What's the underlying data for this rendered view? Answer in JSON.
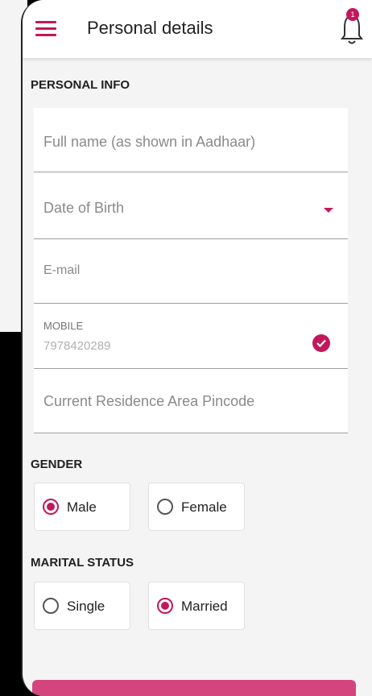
{
  "header": {
    "title": "Personal details",
    "menu_icon": "hamburger-menu-icon",
    "notification_icon": "bell-icon",
    "notification_badge": "1"
  },
  "sections": {
    "personal_info": "PERSONAL INFO",
    "gender": "GENDER",
    "marital_status": "MARITAL STATUS"
  },
  "fields": {
    "full_name": {
      "placeholder": "Full name (as shown in Aadhaar)",
      "value": ""
    },
    "dob": {
      "placeholder": "Date of Birth",
      "value": ""
    },
    "email": {
      "placeholder": "E-mail",
      "value": ""
    },
    "mobile": {
      "label": "MOBILE",
      "value": "7978420289",
      "verified": true
    },
    "pincode": {
      "placeholder": "Current Residence Area Pincode",
      "value": ""
    }
  },
  "gender": {
    "options": [
      "Male",
      "Female"
    ],
    "selected": "Male"
  },
  "marital_status": {
    "options": [
      "Single",
      "Married"
    ],
    "selected": "Married"
  },
  "colors": {
    "accent": "#c2185b",
    "background": "#f4f4f4"
  }
}
